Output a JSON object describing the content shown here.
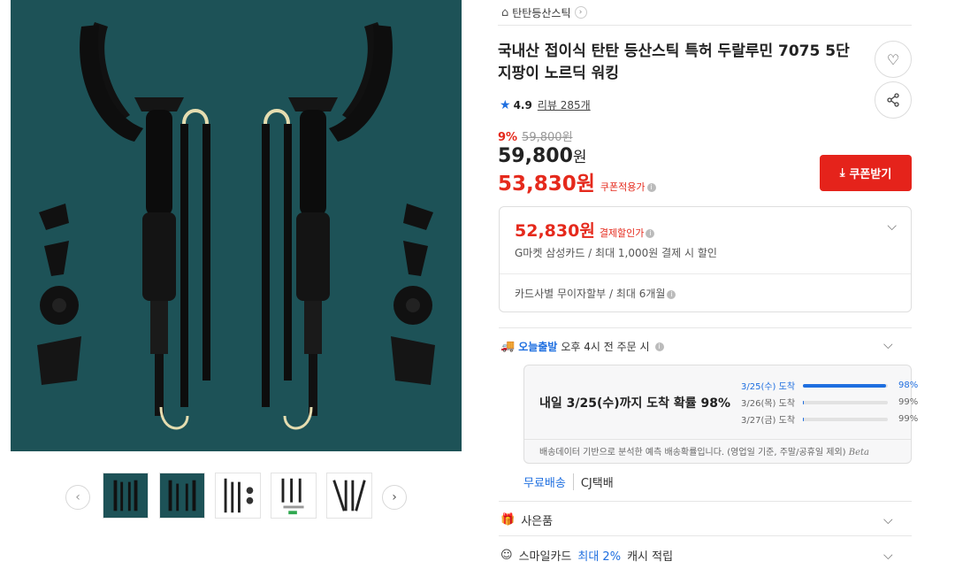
{
  "breadcrumb": {
    "home_icon": "home-icon",
    "category": "탄탄등산스틱",
    "chevron": "›"
  },
  "product": {
    "title": "국내산 접이식 탄탄 등산스틱 특허 두랄루민 7075 5단 지팡이 노르딕 워킹",
    "rating": "4.9",
    "review_label": "리뷰 285개",
    "discount_rate": "9%",
    "original_price": "59,800원",
    "price_number": "59,800",
    "price_unit": "원",
    "coupon_price": "53,830원",
    "coupon_label": "쿠폰적용가",
    "coupon_button": "쿠폰받기"
  },
  "card_benefit": {
    "price": "52,830원",
    "label": "결제할인가",
    "desc": "G마켓 삼성카드 / 최대 1,000원 결제 시 할인",
    "installment": "카드사별 무이자할부 / 최대 6개월"
  },
  "shipping": {
    "badge": "오늘출발",
    "cutoff": "오후 4시 전 주문 시",
    "headline": "내일 3/25(수)까지 도착 확률 98%",
    "probabilities": [
      {
        "date": "3/25(수) 도착",
        "pct": "98%",
        "value": 0.98,
        "active": true
      },
      {
        "date": "3/26(목) 도착",
        "pct": "99%",
        "value": 0.01,
        "active": false
      },
      {
        "date": "3/27(금) 도착",
        "pct": "99%",
        "value": 0.01,
        "active": false
      }
    ],
    "note": "배송데이터 기반으로 분석한 예측 배송확률입니다. (영업일 기준, 주말/공휴일 제외)",
    "beta": "Beta",
    "method_free": "무료배송",
    "method_carrier": "CJ택배"
  },
  "gift": {
    "label": "사은품"
  },
  "smilecard": {
    "prefix": "스마일카드",
    "highlight": "최대 2%",
    "suffix": "캐시 적립"
  },
  "colors": {
    "accent_red": "#e5231b",
    "accent_blue": "#1f6fe0",
    "image_bg": "#1d5257"
  }
}
